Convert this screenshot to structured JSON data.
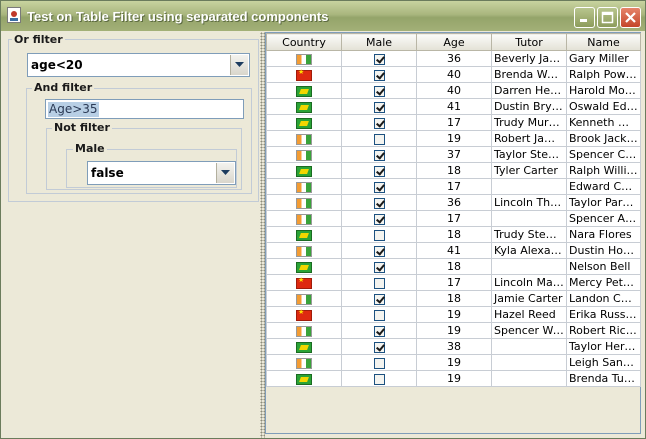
{
  "window": {
    "title": "Test on Table Filter using separated components"
  },
  "filters": {
    "or_filter": {
      "label": "Or filter",
      "value": "age<20"
    },
    "and_filter": {
      "label": "And filter",
      "value": "Age>35"
    },
    "not_filter": {
      "label": "Not filter"
    },
    "male_filter": {
      "label": "Male",
      "value": "false"
    }
  },
  "table": {
    "columns": [
      "Country",
      "Male",
      "Age",
      "Tutor",
      "Name"
    ],
    "rows": [
      {
        "country": "ie",
        "male": true,
        "age": "36",
        "tutor": "Beverly Jackson",
        "name": "Gary Miller"
      },
      {
        "country": "cn",
        "male": true,
        "age": "40",
        "tutor": "Brenda Walker",
        "name": "Ralph Powell"
      },
      {
        "country": "br",
        "male": true,
        "age": "40",
        "tutor": "Darren Hender",
        "name": "Harold Morris"
      },
      {
        "country": "br",
        "male": true,
        "age": "41",
        "tutor": "Dustin Bryant",
        "name": "Oswald Edwards"
      },
      {
        "country": "br",
        "male": true,
        "age": "17",
        "tutor": "Trudy Murphy",
        "name": "Kenneth Walker"
      },
      {
        "country": "ie",
        "male": false,
        "age": "19",
        "tutor": "Robert James",
        "name": "Brook Jackson"
      },
      {
        "country": "ie",
        "male": true,
        "age": "37",
        "tutor": "Taylor Stewart",
        "name": "Spencer Collins"
      },
      {
        "country": "br",
        "male": true,
        "age": "18",
        "tutor": "Tyler Carter",
        "name": "Ralph Williams"
      },
      {
        "country": "ie",
        "male": true,
        "age": "17",
        "tutor": "",
        "name": "Edward Collins"
      },
      {
        "country": "ie",
        "male": true,
        "age": "36",
        "tutor": "Lincoln Thomas",
        "name": "Taylor Parker"
      },
      {
        "country": "ie",
        "male": true,
        "age": "17",
        "tutor": "",
        "name": "Spencer Allen"
      },
      {
        "country": "br",
        "male": false,
        "age": "18",
        "tutor": "Trudy Stewart",
        "name": "Nara Flores"
      },
      {
        "country": "ie",
        "male": true,
        "age": "41",
        "tutor": "Kyla Alexander",
        "name": "Dustin Howard"
      },
      {
        "country": "br",
        "male": true,
        "age": "18",
        "tutor": "",
        "name": "Nelson Bell"
      },
      {
        "country": "cn",
        "male": false,
        "age": "17",
        "tutor": "Lincoln Martin",
        "name": "Mercy Peterson"
      },
      {
        "country": "ie",
        "male": true,
        "age": "18",
        "tutor": "Jamie Carter",
        "name": "Landon Campbell"
      },
      {
        "country": "cn",
        "male": false,
        "age": "19",
        "tutor": "Hazel Reed",
        "name": "Erika Russell"
      },
      {
        "country": "ie",
        "male": true,
        "age": "19",
        "tutor": "Spencer Ward",
        "name": "Robert Richards"
      },
      {
        "country": "br",
        "male": true,
        "age": "38",
        "tutor": "",
        "name": "Taylor Hernandez"
      },
      {
        "country": "ie",
        "male": false,
        "age": "19",
        "tutor": "",
        "name": "Leigh Sanders"
      },
      {
        "country": "br",
        "male": false,
        "age": "19",
        "tutor": "",
        "name": "Brenda Turner"
      }
    ]
  }
}
